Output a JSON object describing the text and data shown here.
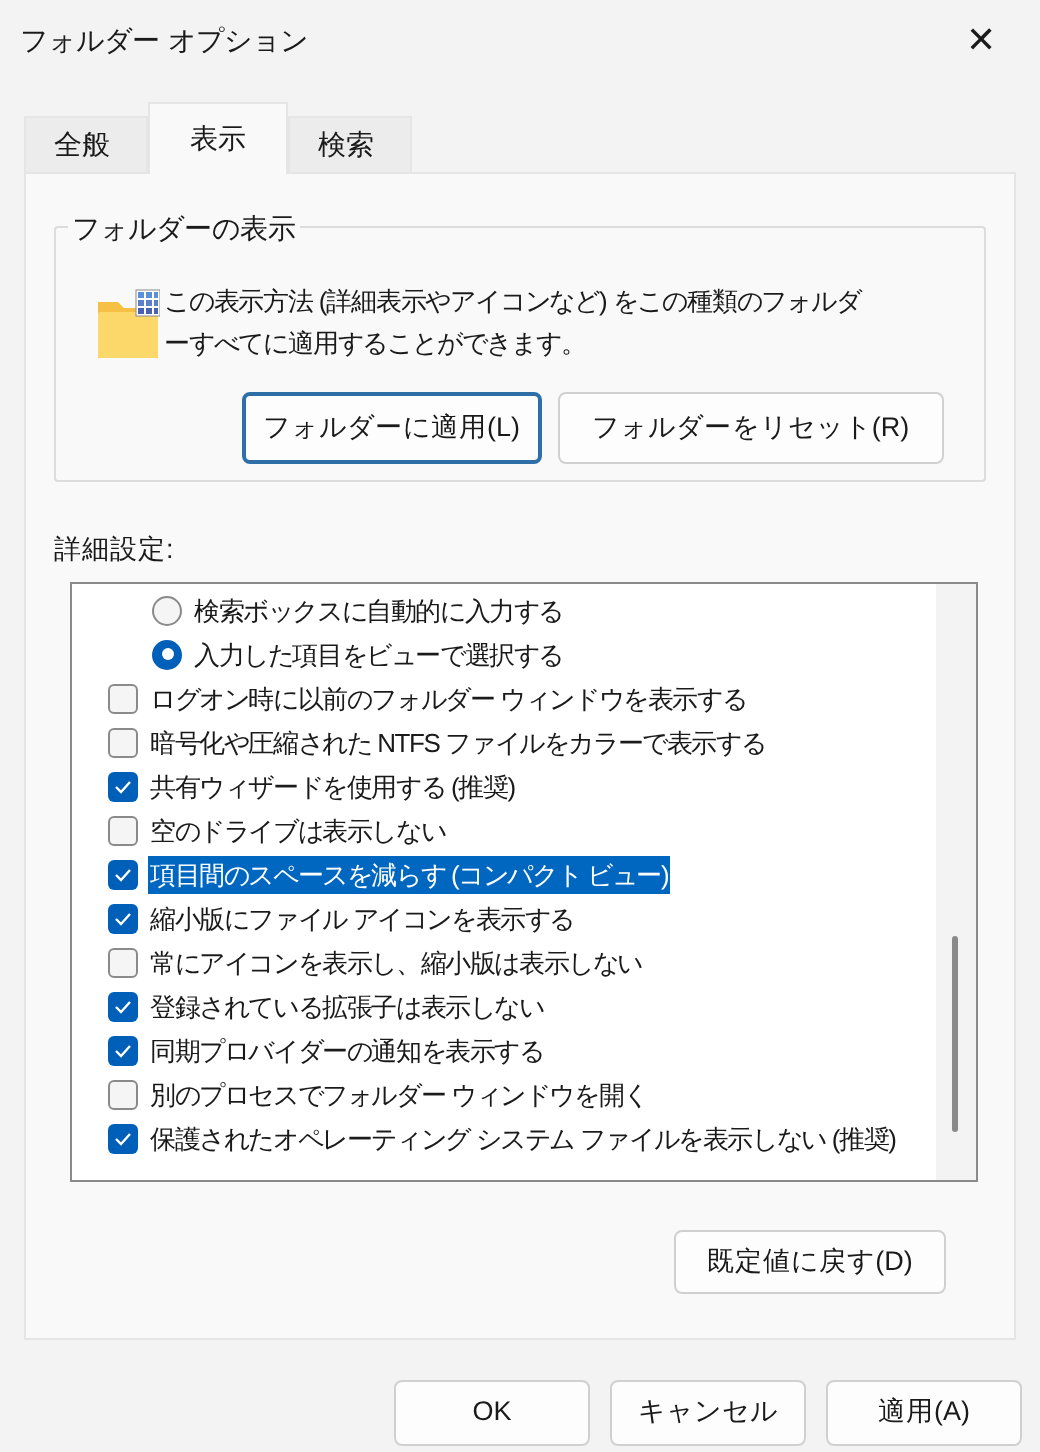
{
  "window": {
    "title": "フォルダー オプション",
    "close": "✕"
  },
  "tabs": [
    {
      "label": "全般",
      "selected": false
    },
    {
      "label": "表示",
      "selected": true
    },
    {
      "label": "検索",
      "selected": false
    }
  ],
  "folder_views": {
    "title": "フォルダーの表示",
    "description": "この表示方法 (詳細表示やアイコンなど) をこの種類のフォルダーすべてに適用することができます。",
    "buttons": [
      {
        "label": "フォルダーに適用(L)",
        "focused": true
      },
      {
        "label": "フォルダーをリセット(R)",
        "focused": false
      }
    ]
  },
  "advanced": {
    "label": "詳細設定:",
    "items": [
      {
        "kind": "radio",
        "label": "検索ボックスに自動的に入力する",
        "checked": false,
        "selected": false
      },
      {
        "kind": "radio",
        "label": "入力した項目をビューで選択する",
        "checked": true,
        "selected": false
      },
      {
        "kind": "checkbox",
        "label": "ログオン時に以前のフォルダー ウィンドウを表示する",
        "checked": false,
        "selected": false
      },
      {
        "kind": "checkbox",
        "label": "暗号化や圧縮された NTFS ファイルをカラーで表示する",
        "checked": false,
        "selected": false
      },
      {
        "kind": "checkbox",
        "label": "共有ウィザードを使用する (推奨)",
        "checked": true,
        "selected": false
      },
      {
        "kind": "checkbox",
        "label": "空のドライブは表示しない",
        "checked": false,
        "selected": false
      },
      {
        "kind": "checkbox",
        "label": "項目間のスペースを減らす (コンパクト ビュー)",
        "checked": true,
        "selected": true
      },
      {
        "kind": "checkbox",
        "label": "縮小版にファイル アイコンを表示する",
        "checked": true,
        "selected": false
      },
      {
        "kind": "checkbox",
        "label": "常にアイコンを表示し、縮小版は表示しない",
        "checked": false,
        "selected": false
      },
      {
        "kind": "checkbox",
        "label": "登録されている拡張子は表示しない",
        "checked": true,
        "selected": false
      },
      {
        "kind": "checkbox",
        "label": "同期プロバイダーの通知を表示する",
        "checked": true,
        "selected": false
      },
      {
        "kind": "checkbox",
        "label": "別のプロセスでフォルダー ウィンドウを開く",
        "checked": false,
        "selected": false
      },
      {
        "kind": "checkbox",
        "label": "保護されたオペレーティング システム ファイルを表示しない (推奨)",
        "checked": true,
        "selected": false
      }
    ],
    "restore_button": "既定値に戻す(D)"
  },
  "footer_buttons": [
    "OK",
    "キャンセル",
    "適用(A)"
  ]
}
